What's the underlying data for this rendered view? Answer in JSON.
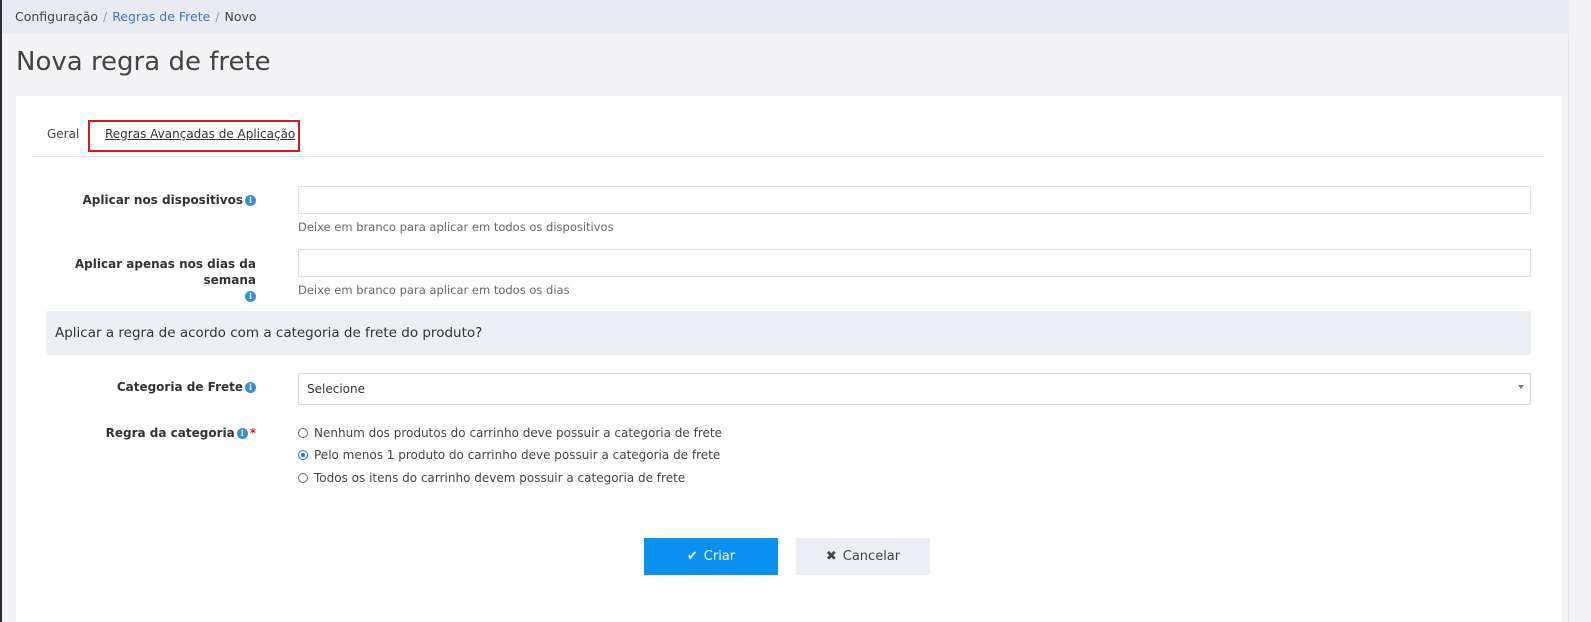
{
  "breadcrumb": {
    "root": "Configuração",
    "parent": "Regras de Frete",
    "current": "Novo"
  },
  "page": {
    "title": "Nova regra de frete"
  },
  "tabs": [
    {
      "label": "Geral"
    },
    {
      "label": "Regras Avançadas de Aplicação"
    }
  ],
  "form": {
    "devices": {
      "label": "Aplicar nos dispositivos",
      "value": "",
      "help": "Deixe em branco para aplicar em todos os dispositivos"
    },
    "weekdays": {
      "label": "Aplicar apenas nos dias da semana",
      "value": "",
      "help": "Deixe em branco para aplicar em todos os dias"
    },
    "section_title": "Aplicar a regra de acordo com a categoria de frete do produto?",
    "category": {
      "label": "Categoria de Frete",
      "selected": "Selecione"
    },
    "category_rule": {
      "label": "Regra da categoria",
      "required_mark": "*",
      "options": [
        {
          "label": "Nenhum dos produtos do carrinho deve possuir a categoria de frete",
          "checked": false
        },
        {
          "label": "Pelo menos 1 produto do carrinho deve possuir a categoria de frete",
          "checked": true
        },
        {
          "label": "Todos os itens do carrinho devem possuir a categoria de frete",
          "checked": false
        }
      ]
    }
  },
  "actions": {
    "create_label": "Criar",
    "cancel_label": "Cancelar"
  },
  "icons": {
    "info": "info-icon",
    "check": "check-icon",
    "close": "close-icon"
  },
  "colors": {
    "primary": "#0a90f0",
    "highlight": "#e0141c",
    "link": "#3b78c4"
  }
}
